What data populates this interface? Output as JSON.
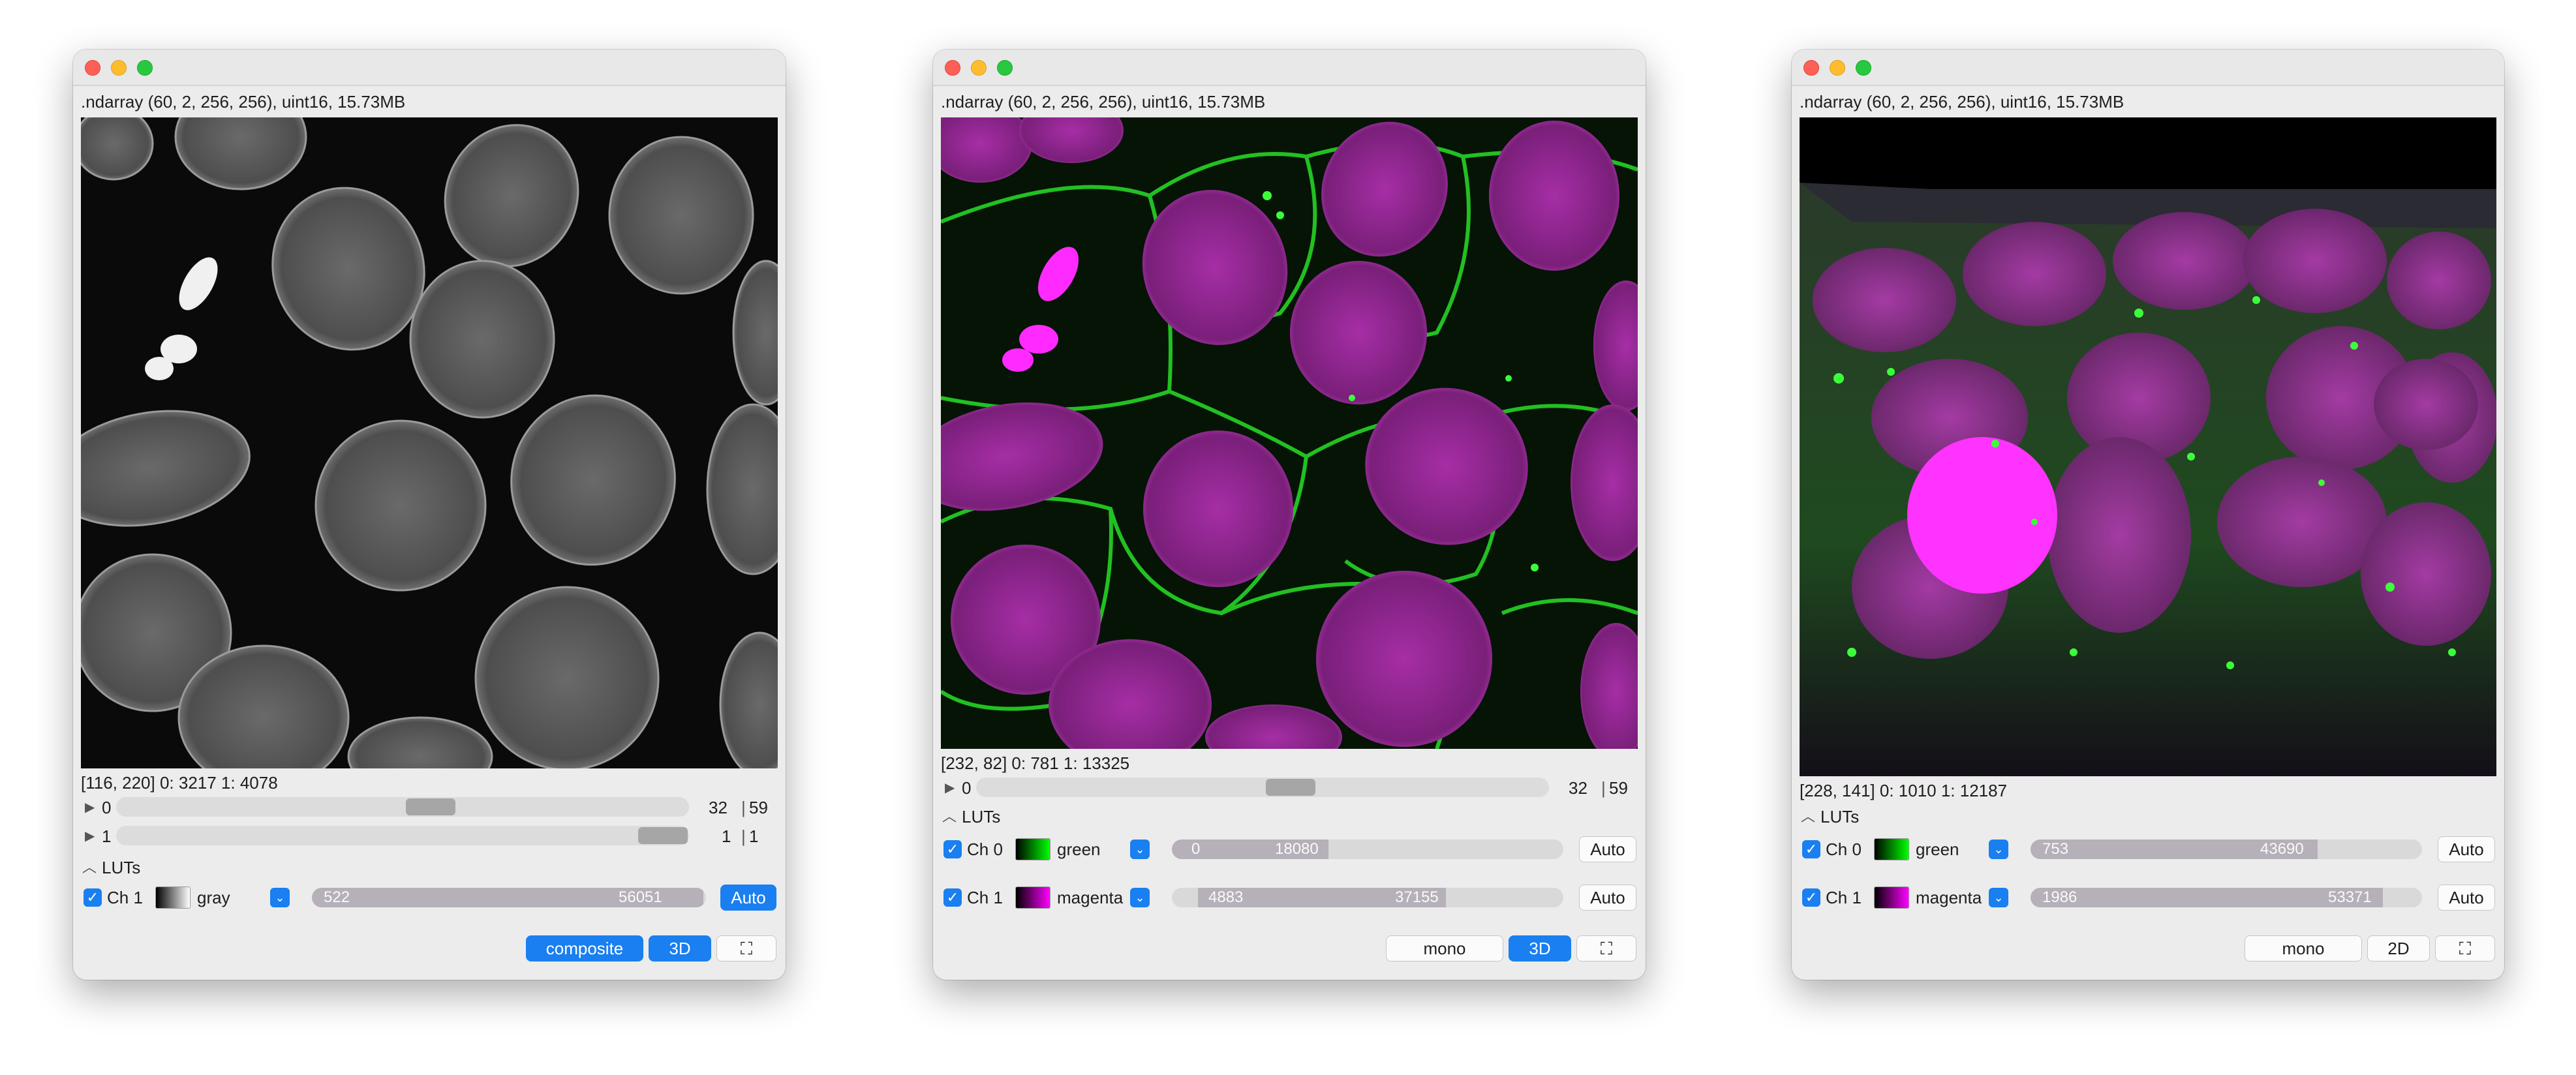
{
  "windows": [
    {
      "info": ".ndarray (60, 2, 256, 256), uint16, 15.73MB",
      "status": "[116, 220] 0: 3217 1: 4078",
      "sliders": [
        {
          "label": "0",
          "value": "32",
          "max": "59",
          "position": 0.56
        },
        {
          "label": "1",
          "value": "1",
          "max": "1",
          "position": 1.0
        }
      ],
      "luts_label": "LUTs",
      "channels": [
        {
          "label": "Ch 1",
          "cmap": "gray",
          "min": "522",
          "max": "56051",
          "auto": "Auto",
          "auto_active": true
        }
      ],
      "buttons": {
        "mode": "composite",
        "view": "3D",
        "fullscreen": "⛶"
      }
    },
    {
      "info": ".ndarray (60, 2, 256, 256), uint16, 15.73MB",
      "status": "[232, 82] 0: 781 1: 13325",
      "sliders": [
        {
          "label": "0",
          "value": "32",
          "max": "59",
          "position": 0.56
        }
      ],
      "luts_label": "LUTs",
      "channels": [
        {
          "label": "Ch 0",
          "cmap": "green",
          "min": "0",
          "max": "18080",
          "auto": "Auto",
          "auto_active": false
        },
        {
          "label": "Ch 1",
          "cmap": "magenta",
          "min": "4883",
          "max": "37155",
          "auto": "Auto",
          "auto_active": false
        }
      ],
      "buttons": {
        "mode": "mono",
        "view": "3D",
        "fullscreen": "⛶"
      }
    },
    {
      "info": ".ndarray (60, 2, 256, 256), uint16, 15.73MB",
      "status": "[228, 141] 0: 1010 1: 12187",
      "luts_label": "LUTs",
      "channels": [
        {
          "label": "Ch 0",
          "cmap": "green",
          "min": "753",
          "max": "43690",
          "auto": "Auto",
          "auto_active": false
        },
        {
          "label": "Ch 1",
          "cmap": "magenta",
          "min": "1986",
          "max": "53371",
          "auto": "Auto",
          "auto_active": false
        }
      ],
      "buttons": {
        "mode": "mono",
        "view": "2D",
        "fullscreen": "⛶"
      }
    }
  ],
  "colors": {
    "accent": "#1a7ff0",
    "gray_lut": "#ffffff",
    "green_lut": "#00ff00",
    "magenta_lut": "#ff00ff"
  }
}
